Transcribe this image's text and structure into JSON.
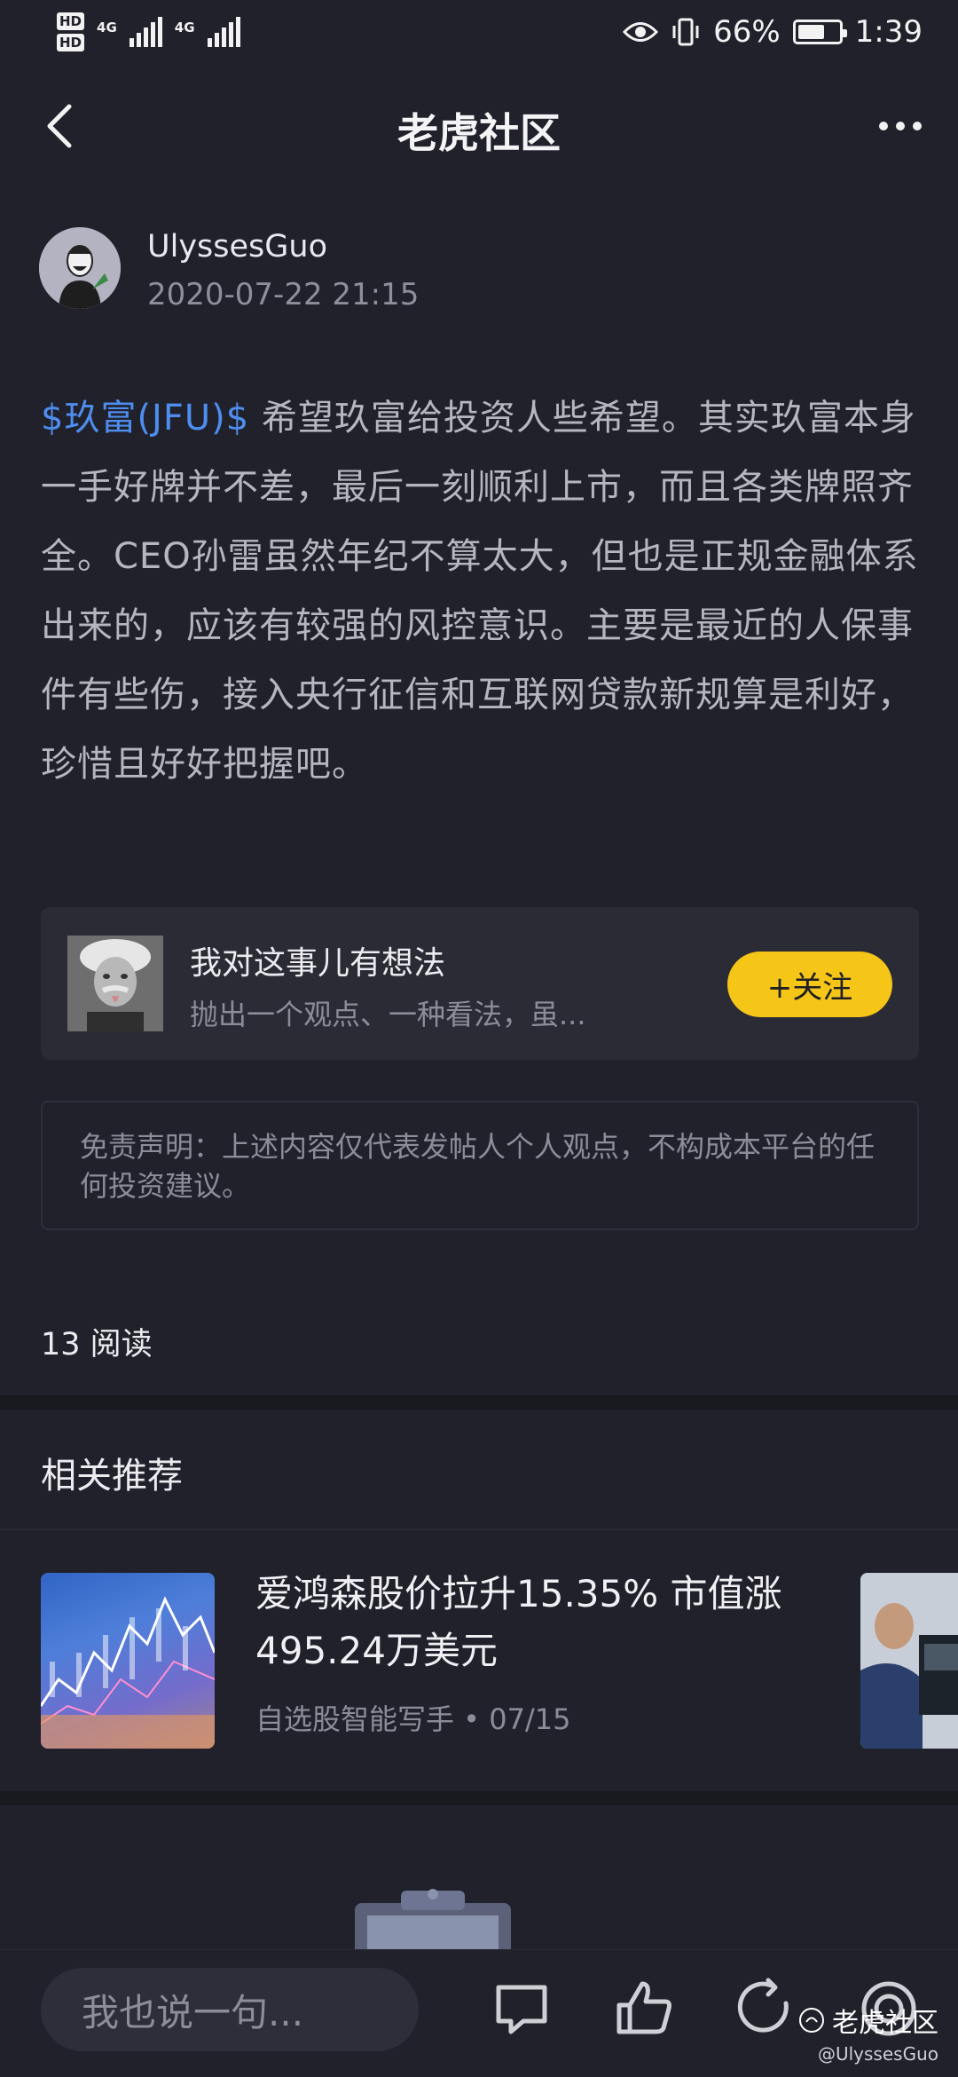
{
  "status_bar": {
    "hd1": "HD",
    "hd2": "HD",
    "net1": "4G",
    "net2": "4G",
    "battery_percent": "66%",
    "battery_level": 0.66,
    "time": "1:39"
  },
  "nav": {
    "title": "老虎社区"
  },
  "author": {
    "name": "UlyssesGuo",
    "timestamp": "2020-07-22 21:15"
  },
  "post": {
    "ticker": "$玖富(JFU)$",
    "text": " 希望玖富给投资人些希望。其实玖富本身一手好牌并不差，最后一刻顺利上市，而且各类牌照齐全。CEO孙雷虽然年纪不算太大，但也是正规金融体系出来的，应该有较强的风控意识。主要是最近的人保事件有些伤，接入央行征信和互联网贷款新规算是利好，珍惜且好好把握吧。"
  },
  "user_card": {
    "title": "我对这事儿有想法",
    "subtitle": "抛出一个观点、一种看法，虽...",
    "follow_label": "+关注"
  },
  "disclaimer": {
    "text": "免责声明：上述内容仅代表发帖人个人观点，不构成本平台的任何投资建议。"
  },
  "stats": {
    "read_count": "13 阅读"
  },
  "recommend": {
    "section_title": "相关推荐",
    "items": [
      {
        "headline": "爱鸿森股价拉升15.35% 市值涨495.24万美元",
        "meta": "自选股智能写手 • 07/15"
      }
    ]
  },
  "bottom_bar": {
    "comment_placeholder": "我也说一句..."
  },
  "watermark": {
    "main": "老虎社区",
    "sub": "@UlyssesGuo"
  },
  "colors": {
    "background": "#21212b",
    "ticker_blue": "#4d8ef0",
    "follow_yellow": "#f5c518",
    "card_bg": "#2b2b36"
  }
}
